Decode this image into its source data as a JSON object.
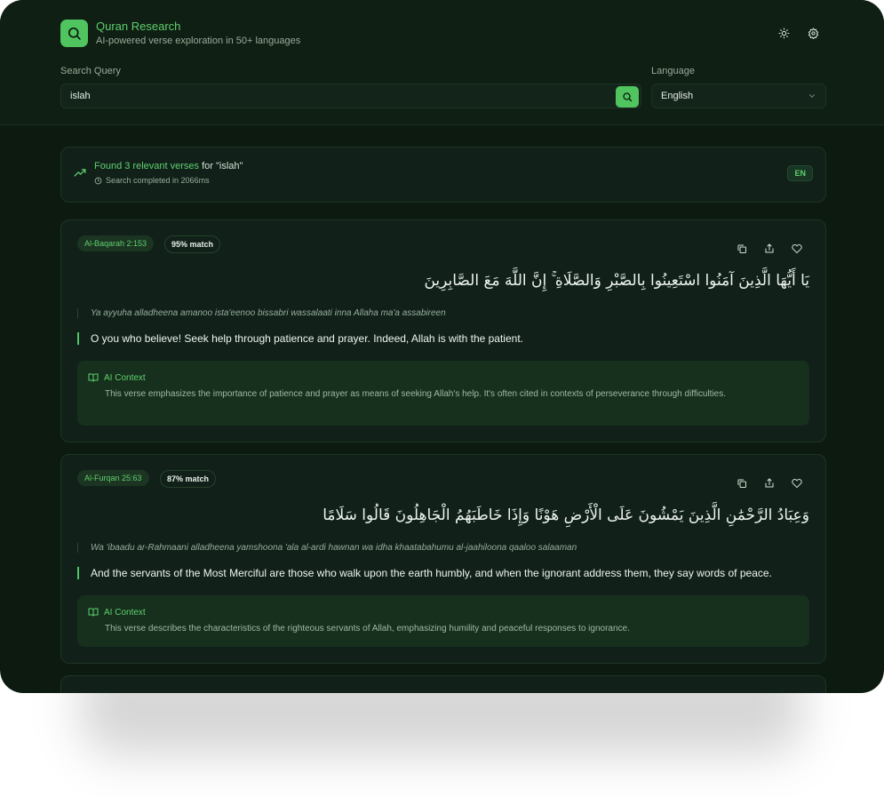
{
  "app": {
    "title": "Quran Research",
    "subtitle": "AI-powered verse exploration in 50+ languages"
  },
  "header_icons": [
    "sun-icon",
    "gear-icon"
  ],
  "search": {
    "label": "Search Query",
    "value": "islah"
  },
  "language": {
    "label": "Language",
    "value": "English"
  },
  "summary": {
    "found": "Found 3 relevant verses",
    "for_text": " for \"islah\"",
    "time": "Search completed in 2066ms",
    "lang_code": "EN"
  },
  "colors": {
    "accent": "#4fc45f",
    "background": "#0c1a0f",
    "card": "#11211a"
  },
  "results": [
    {
      "ref": "Al-Baqarah 2:153",
      "match": "95% match",
      "arabic": "يَا أَيُّهَا الَّذِينَ آمَنُوا اسْتَعِينُوا بِالصَّبْرِ وَالصَّلَاةِ ۚ إِنَّ اللَّهَ مَعَ الصَّابِرِينَ",
      "transliteration": "Ya ayyuha alladheena amanoo ista'eenoo bissabri wassalaati inna Allaha ma'a assabireen",
      "translation": "O you who believe! Seek help through patience and prayer. Indeed, Allah is with the patient.",
      "context_label": "AI Context",
      "context": "This verse emphasizes the importance of patience and prayer as means of seeking Allah's help. It's often cited in contexts of perseverance through difficulties."
    },
    {
      "ref": "Al-Furqan 25:63",
      "match": "87% match",
      "arabic": "وَعِبَادُ الرَّحْمَٰنِ الَّذِينَ يَمْشُونَ عَلَى الْأَرْضِ هَوْنًا وَإِذَا خَاطَبَهُمُ الْجَاهِلُونَ قَالُوا سَلَامًا",
      "transliteration": "Wa 'ibaadu ar-Rahmaani alladheena yamshoona 'ala al-ardi hawnan wa idha khaatabahumu al-jaahiloona qaaloo salaaman",
      "translation": "And the servants of the Most Merciful are those who walk upon the earth humbly, and when the ignorant address them, they say words of peace.",
      "context_label": "AI Context",
      "context": "This verse describes the characteristics of the righteous servants of Allah, emphasizing humility and peaceful responses to ignorance."
    }
  ]
}
